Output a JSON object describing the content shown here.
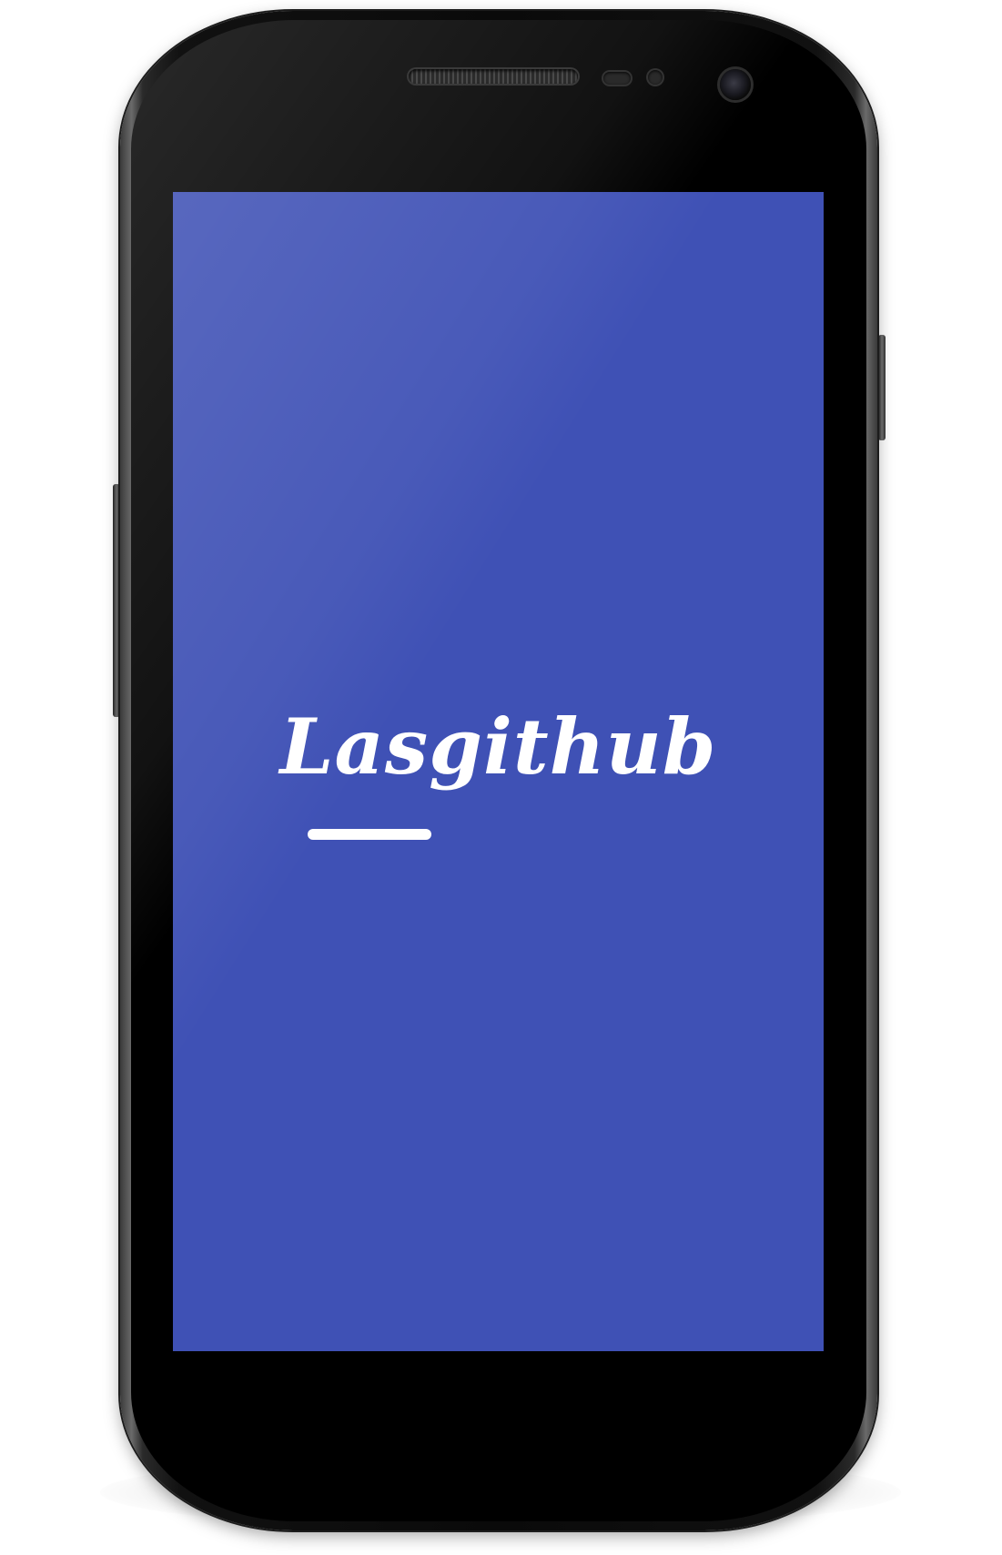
{
  "app": {
    "name": "Lasgithub"
  },
  "colors": {
    "screen_background": "#3f51b5",
    "logo_text": "#ffffff",
    "device_body": "#0a0a0a"
  },
  "device": {
    "type": "android-phone-mockup",
    "icons": [
      "speaker-grille",
      "proximity-sensor",
      "front-camera"
    ]
  }
}
